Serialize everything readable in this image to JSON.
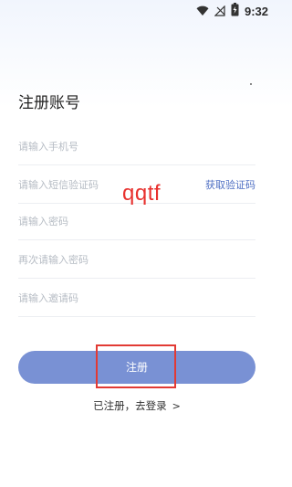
{
  "status_bar": {
    "time": "9:32",
    "icons": [
      "wifi-icon",
      "no-signal-icon",
      "battery-icon"
    ]
  },
  "title": "注册账号",
  "fields": [
    {
      "placeholder": "请输入手机号"
    },
    {
      "placeholder": "请输入短信验证码",
      "action": "获取验证码"
    },
    {
      "placeholder": "请输入密码"
    },
    {
      "placeholder": "再次请输入密码"
    },
    {
      "placeholder": "请输入邀请码"
    }
  ],
  "watermark": "qqtf",
  "register_button": "注册",
  "login_link": "已注册，去登录",
  "colors": {
    "primary_button": "#7991d4",
    "link_blue": "#4f6fc3",
    "highlight_red": "#e23a34"
  }
}
